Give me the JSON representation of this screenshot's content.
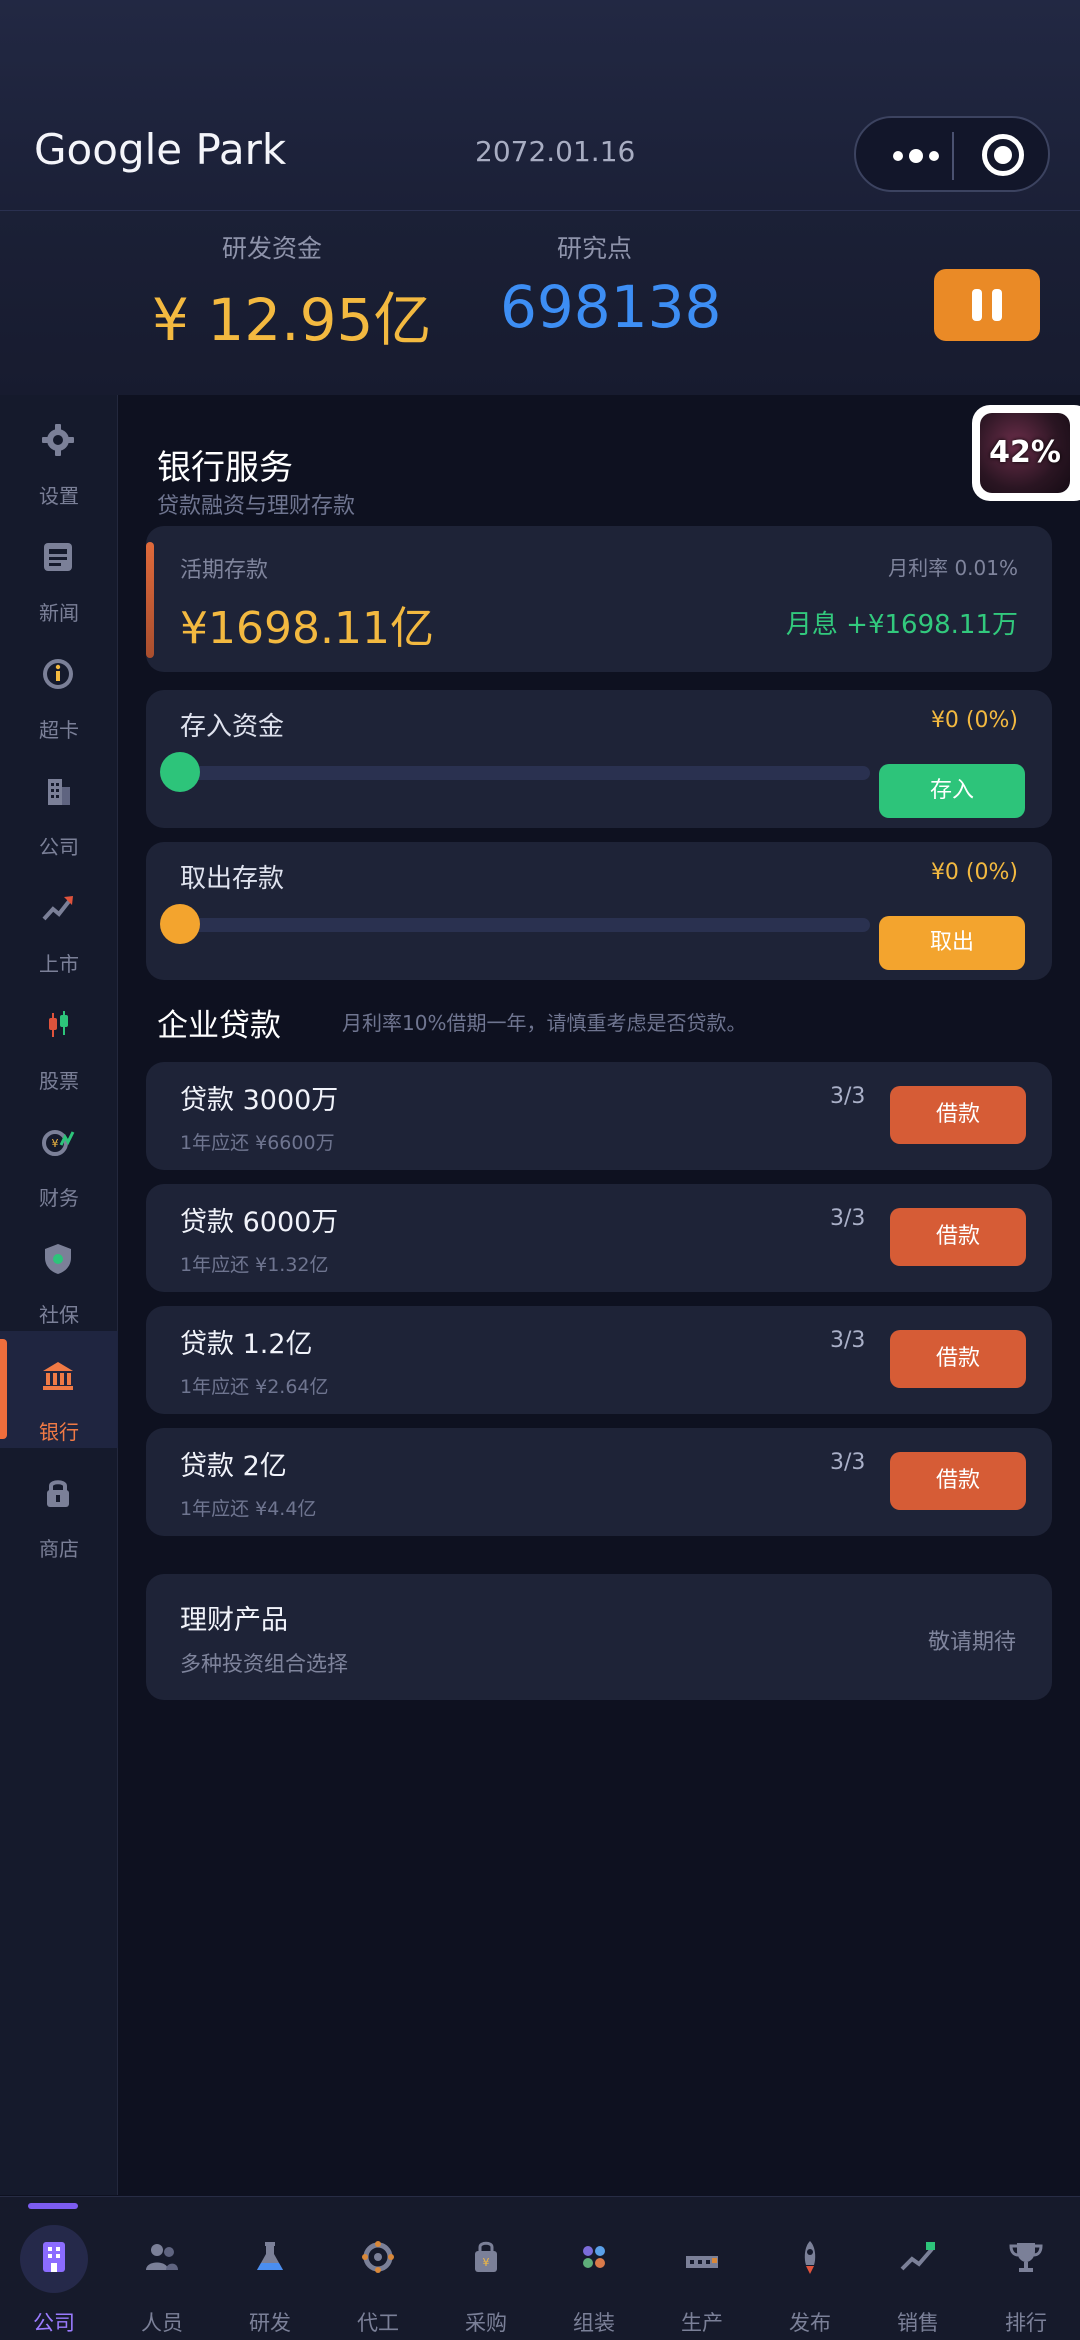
{
  "header": {
    "company": "Google Park",
    "date": "2072.01.16"
  },
  "stats": {
    "fund_label": "研发资金",
    "fund_value": "¥ 12.95亿",
    "rp_label": "研究点",
    "rp_value": "698138"
  },
  "progress_badge": {
    "value": "42%"
  },
  "sidebar": {
    "items": [
      {
        "label": "设置",
        "icon": "gear-icon"
      },
      {
        "label": "新闻",
        "icon": "newspaper-icon"
      },
      {
        "label": "超卡",
        "icon": "info-icon"
      },
      {
        "label": "公司",
        "icon": "building-icon"
      },
      {
        "label": "上市",
        "icon": "trend-up-icon"
      },
      {
        "label": "股票",
        "icon": "candlestick-icon"
      },
      {
        "label": "财务",
        "icon": "finance-icon"
      },
      {
        "label": "社保",
        "icon": "shield-icon"
      },
      {
        "label": "银行",
        "icon": "bank-icon"
      },
      {
        "label": "商店",
        "icon": "lock-icon"
      }
    ]
  },
  "bank": {
    "title": "银行服务",
    "subtitle": "贷款融资与理财存款",
    "deposit": {
      "label": "活期存款",
      "rate": "月利率 0.01%",
      "amount": "¥1698.11亿",
      "interest": "月息 +¥1698.11万"
    },
    "deposit_slider": {
      "label": "存入资金",
      "value": "¥0 (0%)",
      "button": "存入",
      "level": 0
    },
    "withdraw_slider": {
      "label": "取出存款",
      "value": "¥0 (0%)",
      "button": "取出",
      "level": 0
    }
  },
  "loans": {
    "title": "企业贷款",
    "note": "月利率10%借期一年，请慎重考虑是否贷款。",
    "items": [
      {
        "title": "贷款 3000万",
        "repay": "1年应还 ¥6600万",
        "count": "3/3",
        "button": "借款"
      },
      {
        "title": "贷款 6000万",
        "repay": "1年应还 ¥1.32亿",
        "count": "3/3",
        "button": "借款"
      },
      {
        "title": "贷款 1.2亿",
        "repay": "1年应还 ¥2.64亿",
        "count": "3/3",
        "button": "借款"
      },
      {
        "title": "贷款 2亿",
        "repay": "1年应还 ¥4.4亿",
        "count": "3/3",
        "button": "借款"
      }
    ]
  },
  "wealth": {
    "title": "理财产品",
    "subtitle": "多种投资组合选择",
    "status": "敬请期待"
  },
  "bottom_nav": {
    "items": [
      {
        "label": "公司",
        "icon": "office-building-icon"
      },
      {
        "label": "人员",
        "icon": "people-icon"
      },
      {
        "label": "研发",
        "icon": "flask-icon"
      },
      {
        "label": "代工",
        "icon": "gear-cog-icon"
      },
      {
        "label": "采购",
        "icon": "shopping-bag-icon"
      },
      {
        "label": "组装",
        "icon": "components-icon"
      },
      {
        "label": "生产",
        "icon": "factory-icon"
      },
      {
        "label": "发布",
        "icon": "rocket-icon"
      },
      {
        "label": "销售",
        "icon": "sales-chart-icon"
      },
      {
        "label": "排行",
        "icon": "trophy-icon"
      }
    ]
  },
  "colors": {
    "accent_orange": "#ea8a26",
    "gold": "#f3b940",
    "blue": "#3d8ef4",
    "green": "#2dc47a",
    "loan_red": "#d65c36",
    "nav_active": "#9a7bff"
  }
}
